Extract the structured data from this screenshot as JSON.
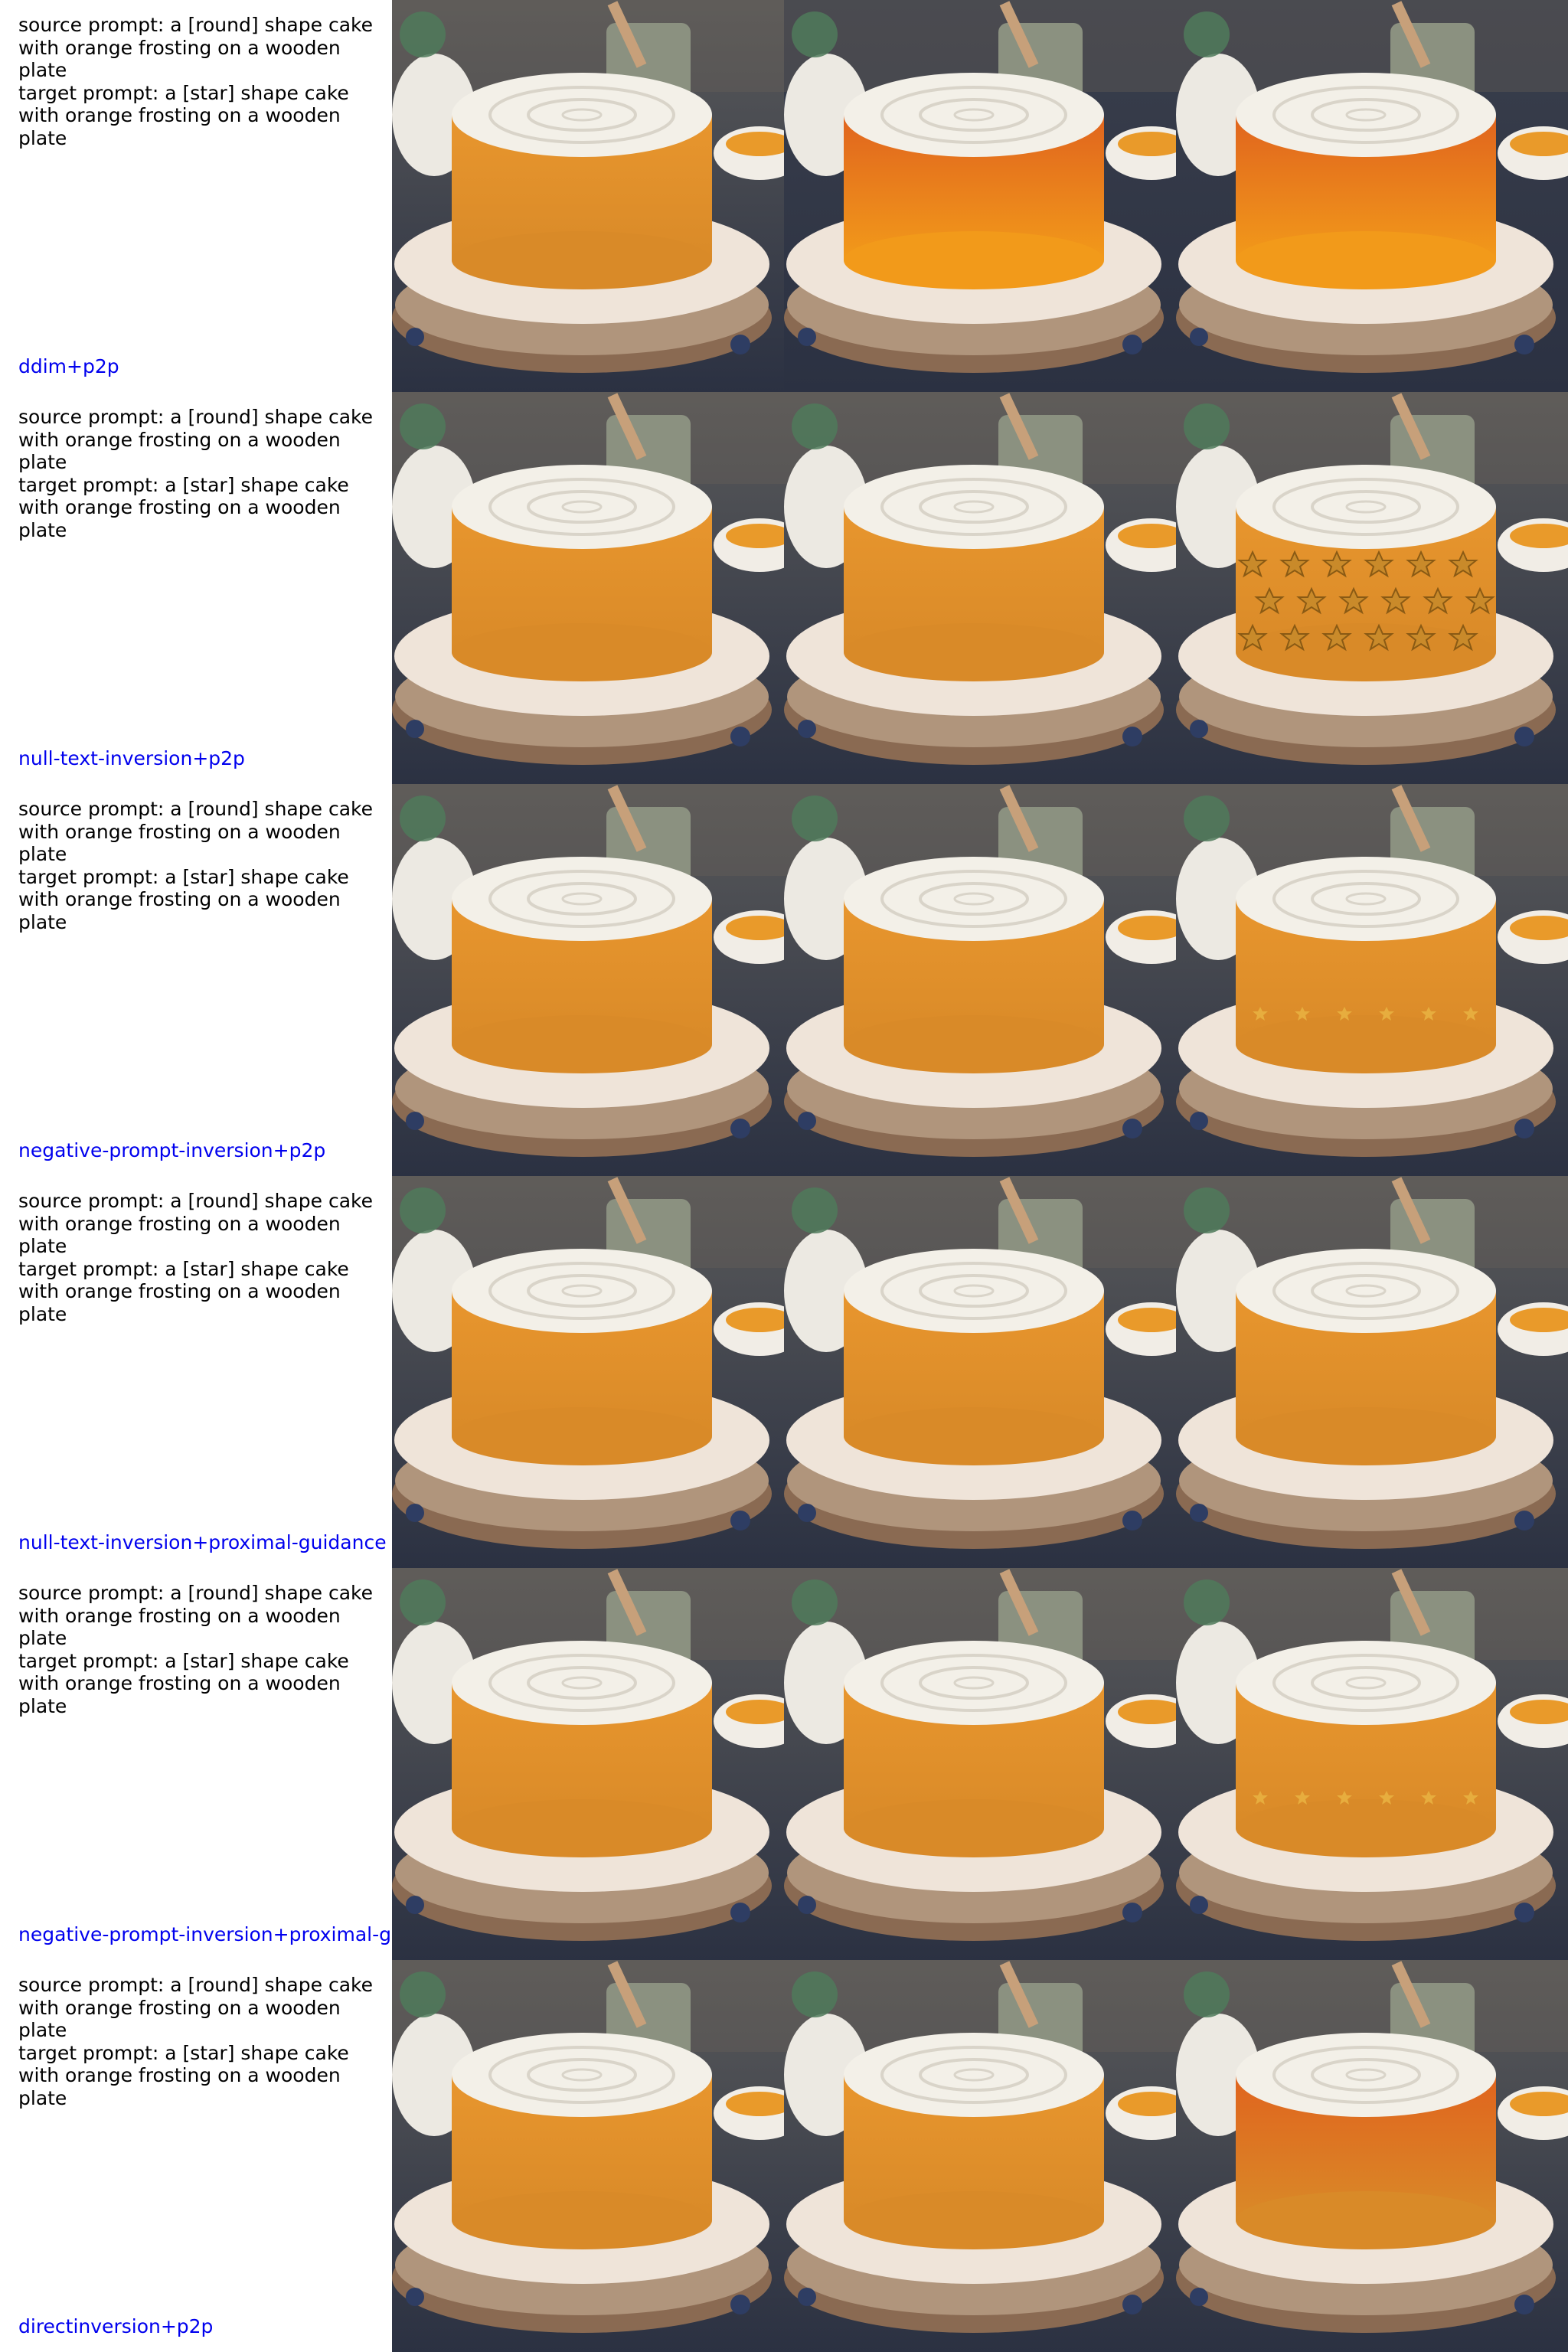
{
  "rows": [
    {
      "prompt_text": "source prompt: a [round] shape cake\nwith orange frosting on a wooden\nplate\ntarget prompt: a [star] shape cake\nwith orange frosting on a wooden\nplate",
      "method": "ddim+p2p",
      "images": [
        "cake-original-photo",
        "cake-reconstruction-photo",
        "cake-edited-photo"
      ]
    },
    {
      "prompt_text": "source prompt: a [round] shape cake\nwith orange frosting on a wooden\nplate\ntarget prompt: a [star] shape cake\nwith orange frosting on a wooden\nplate",
      "method": "null-text-inversion+p2p",
      "images": [
        "cake-original-photo",
        "cake-reconstruction-photo",
        "cake-star-decorated-photo"
      ]
    },
    {
      "prompt_text": "source prompt: a [round] shape cake\nwith orange frosting on a wooden\nplate\ntarget prompt: a [star] shape cake\nwith orange frosting on a wooden\nplate",
      "method": "negative-prompt-inversion+p2p",
      "images": [
        "cake-original-photo",
        "cake-reconstruction-photo",
        "cake-star-decorated-photo"
      ]
    },
    {
      "prompt_text": "source prompt: a [round] shape cake\nwith orange frosting on a wooden\nplate\ntarget prompt: a [star] shape cake\nwith orange frosting on a wooden\nplate",
      "method": "null-text-inversion+proximal-guidance",
      "images": [
        "cake-original-photo",
        "cake-reconstruction-photo",
        "cake-edited-photo"
      ]
    },
    {
      "prompt_text": "source prompt: a [round] shape cake\nwith orange frosting on a wooden\nplate\ntarget prompt: a [star] shape cake\nwith orange frosting on a wooden\nplate",
      "method": "negative-prompt-inversion+proximal-g",
      "images": [
        "cake-original-photo",
        "cake-reconstruction-photo",
        "cake-star-decorated-photo"
      ]
    },
    {
      "prompt_text": "source prompt: a [round] shape cake\nwith orange frosting on a wooden\nplate\ntarget prompt: a [star] shape cake\nwith orange frosting on a wooden\nplate",
      "method": "directinversion+p2p",
      "images": [
        "cake-original-photo",
        "cake-reconstruction-photo",
        "cake-edited-photo"
      ]
    }
  ],
  "colors": {
    "method_label": "#0000ee",
    "prompt_text": "#000000",
    "cake_orange": "#e8962e",
    "frosting": "#f3f0e8",
    "tablecloth": "#2b3142"
  }
}
